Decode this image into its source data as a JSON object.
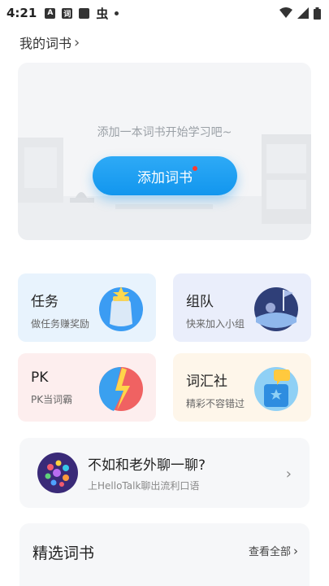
{
  "status_bar": {
    "time": "4:21",
    "icons": [
      "a-box-icon",
      "word-app-icon",
      "square-icon",
      "bug-icon",
      "dot-icon",
      "wifi-icon",
      "signal-icon",
      "battery-icon"
    ],
    "a_label": "A",
    "ci_label": "词",
    "bug_label": "虫"
  },
  "my_books": {
    "title": "我的词书",
    "chevron": "›",
    "empty_text": "添加一本词书开始学习吧~",
    "add_button": "添加词书"
  },
  "tiles": {
    "task": {
      "title": "任务",
      "subtitle": "做任务赚奖励"
    },
    "team": {
      "title": "组队",
      "subtitle": "快来加入小组"
    },
    "pk": {
      "title": "PK",
      "subtitle": "PK当词霸"
    },
    "club": {
      "title": "词汇社",
      "subtitle": "精彩不容错过"
    }
  },
  "hellotalk": {
    "title": "不如和老外聊一聊?",
    "subtitle": "上HelloTalk聊出流利口语",
    "chevron": "›"
  },
  "selected_books": {
    "title": "精选词书",
    "view_all": "查看全部",
    "chevron": "›"
  },
  "colors": {
    "accent": "#1a9cf0",
    "red_dot": "#ff3b30",
    "task_bg": "#e8f3fd",
    "team_bg": "#eaeefb",
    "pk_bg": "#fdeeee",
    "club_bg": "#fef6ea"
  }
}
